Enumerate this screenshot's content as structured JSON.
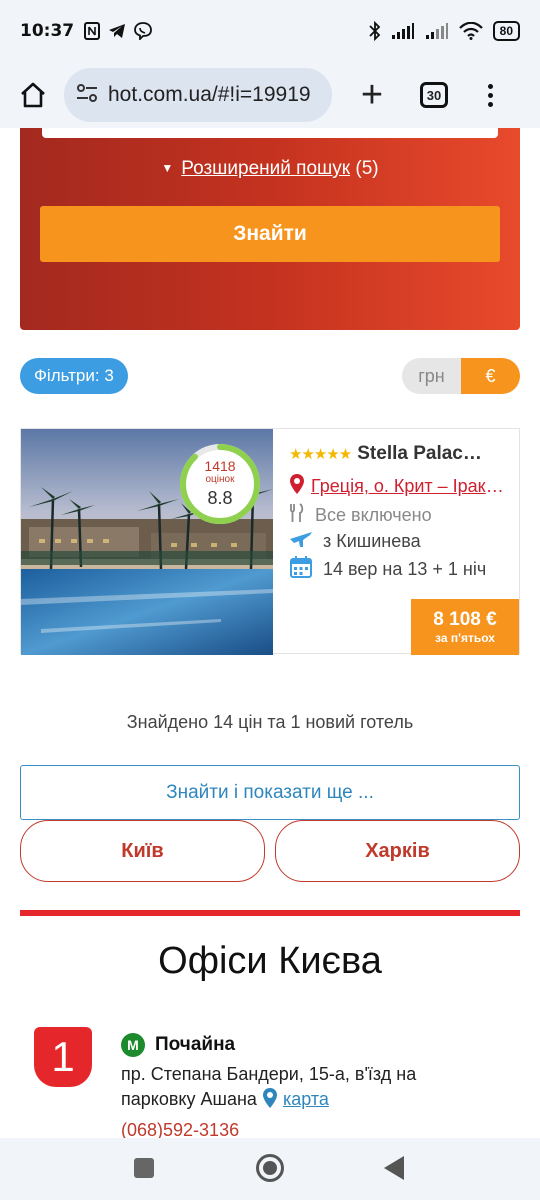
{
  "statusbar": {
    "time": "10:37",
    "battery": "80",
    "icons": [
      "nfc-icon",
      "telegram-icon",
      "viber-icon",
      "bluetooth-icon",
      "signal-icon",
      "signal2-icon",
      "wifi-icon"
    ]
  },
  "browser": {
    "url": "hot.com.ua/#!i=19919",
    "tab_count": "30"
  },
  "search": {
    "advanced_label": "Розширений пошук",
    "advanced_count": "(5)",
    "find_label": "Знайти"
  },
  "filters": {
    "label": "Фільтри: 3"
  },
  "currency": {
    "uah": "грн",
    "eur": "€",
    "selected": "€"
  },
  "hotel": {
    "stars": "★★★★★",
    "name": "Stella Palace Resort & Spa",
    "name_display": "Stella Palac…",
    "location": "Греція, о. Крит – Іракліон",
    "rating_count": "1418",
    "rating_label": "оцінок",
    "rating_score": "8.8",
    "rating_fraction": 0.88,
    "meal": "Все включено",
    "departure": "з Кишинева",
    "dates": "14 вер на 13 + 1 ніч",
    "price": "8 108 €",
    "price_sub": "за п'ятьох"
  },
  "results": {
    "found_text": "Знайдено 14 цін та 1 новий готель",
    "more_label": "Знайти і показати ще ..."
  },
  "cities": {
    "kyiv": "Київ",
    "kharkiv": "Харків"
  },
  "offices": {
    "title": "Офіси Києва",
    "items": [
      {
        "number": "1",
        "metro_badge": "М",
        "metro": "Почайна",
        "address": "пр. Степана Бандери, 15-а, в'їзд на парковку Ашана",
        "map_label": "карта",
        "phone": "(068)592-3136"
      }
    ]
  },
  "colors": {
    "accent_orange": "#f7941d",
    "brand_red": "#e5262a",
    "filter_blue": "#3d9de3",
    "metro_green": "#1d8a2e"
  }
}
